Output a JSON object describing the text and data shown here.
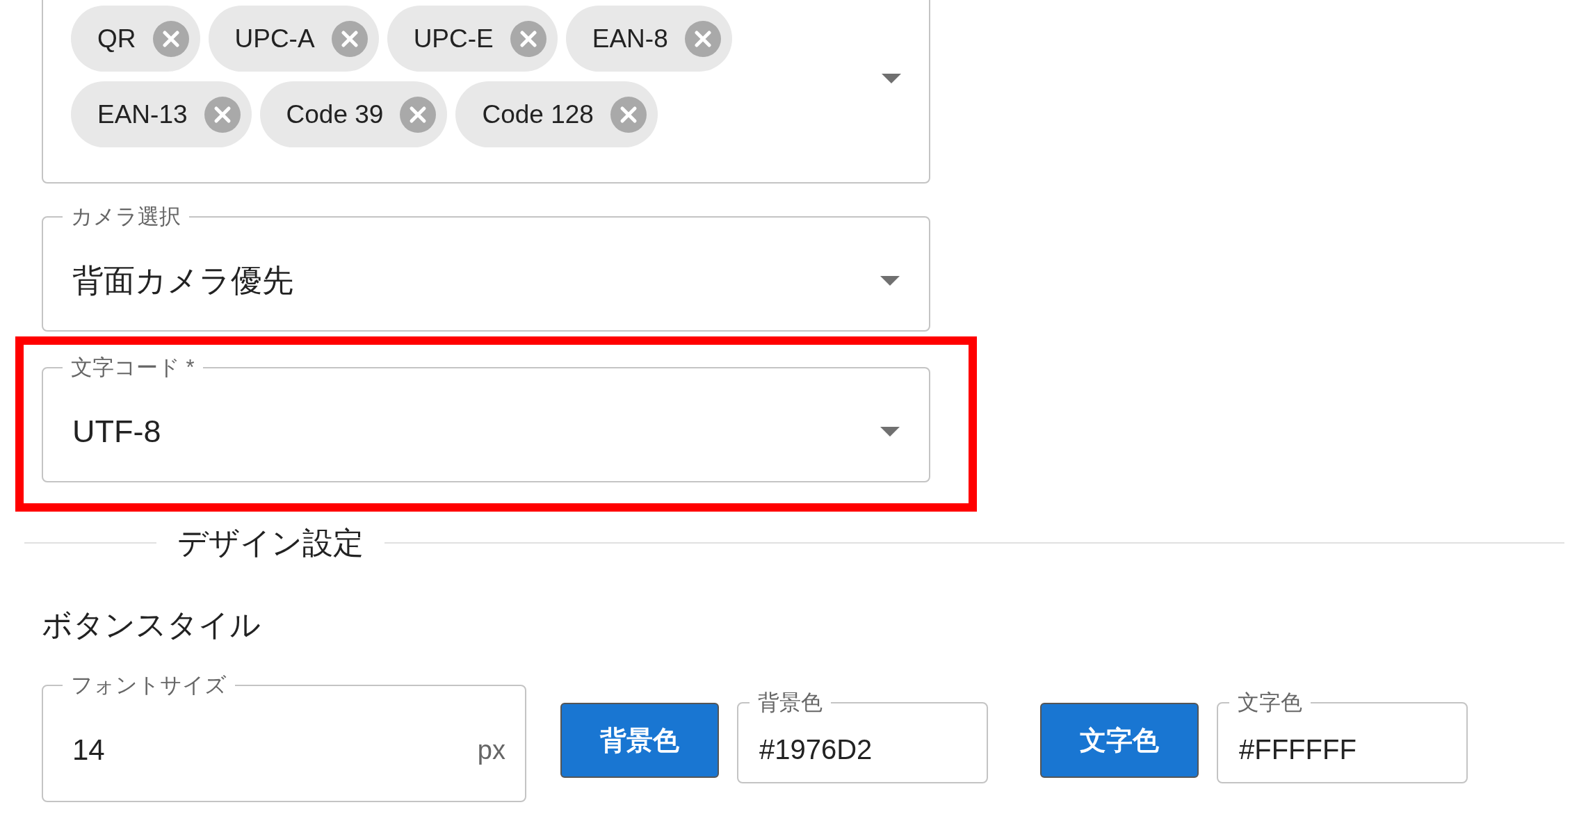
{
  "barcode_formats": {
    "chips": [
      {
        "label": "QR"
      },
      {
        "label": "UPC-A"
      },
      {
        "label": "UPC-E"
      },
      {
        "label": "EAN-8"
      },
      {
        "label": "EAN-13"
      },
      {
        "label": "Code 39"
      },
      {
        "label": "Code 128"
      }
    ]
  },
  "camera_select": {
    "label": "カメラ選択",
    "value": "背面カメラ優先"
  },
  "charset_select": {
    "label": "文字コード *",
    "value": "UTF-8",
    "highlighted": true
  },
  "design_section": {
    "title": "デザイン設定"
  },
  "button_style": {
    "heading": "ボタンスタイル",
    "font_size": {
      "label": "フォントサイズ",
      "value": "14",
      "suffix": "px"
    },
    "colors": [
      {
        "kind": "background",
        "button": "背景色",
        "label": "背景色",
        "value": "#1976D2"
      },
      {
        "kind": "text",
        "button": "文字色",
        "label": "文字色",
        "value": "#FFFFFF"
      }
    ]
  }
}
